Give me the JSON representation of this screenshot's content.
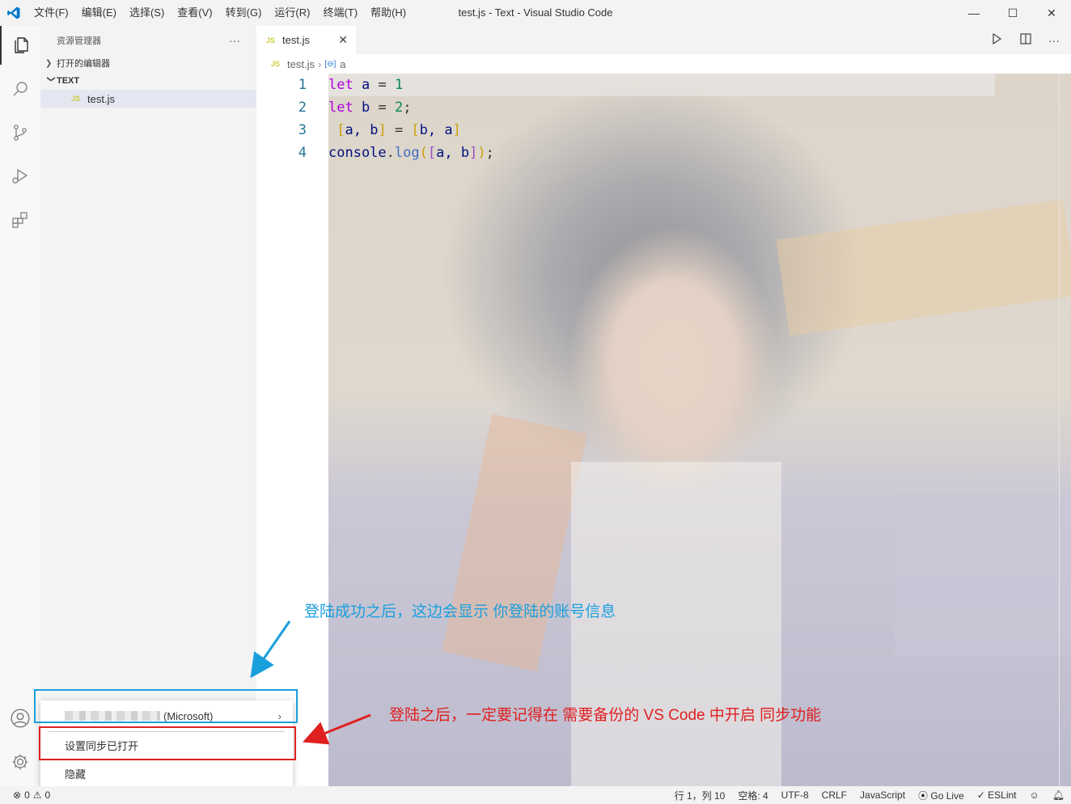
{
  "titlebar": {
    "menus": [
      "文件(F)",
      "编辑(E)",
      "选择(S)",
      "查看(V)",
      "转到(G)",
      "运行(R)",
      "终端(T)",
      "帮助(H)"
    ],
    "title": "test.js - Text - Visual Studio Code",
    "minimize": "—",
    "maximize": "☐",
    "close": "✕"
  },
  "sidebar": {
    "title": "资源管理器",
    "more": "···",
    "open_editors": "打开的编辑器",
    "folder": "TEXT",
    "file_badge": "JS",
    "file": "test.js"
  },
  "tab": {
    "badge": "JS",
    "label": "test.js",
    "close": "✕"
  },
  "breadcrumb": {
    "file_badge": "JS",
    "file": "test.js",
    "symbol_badge": "[⊖]",
    "symbol": "a"
  },
  "editor": {
    "line_numbers": [
      "1",
      "2",
      "3",
      "4"
    ],
    "code": {
      "l1_kw": "let",
      "l1_id": "a",
      "l1_op": " = ",
      "l1_num": "1",
      "l2_kw": "let",
      "l2_id": "b",
      "l2_op": " = ",
      "l2_num": "2",
      "l2_end": ";",
      "l3_pre": " ",
      "l3_open": "[",
      "l3_mid1": "a, b",
      "l3_close": "]",
      "l3_op": " = ",
      "l3_open2": "[",
      "l3_mid2": "b, a",
      "l3_close2": "]",
      "l4_obj": "console",
      "l4_dot": ".",
      "l4_fn": "log",
      "l4_p1": "(",
      "l4_b1": "[",
      "l4_args": "a, b",
      "l4_b2": "]",
      "l4_p2": ")",
      "l4_end": ";"
    }
  },
  "account_menu": {
    "account_suffix": "(Microsoft)",
    "sync": "设置同步已打开",
    "hide": "隐藏",
    "arrow": "›"
  },
  "annotations": {
    "blue": "登陆成功之后，这边会显示 你登陆的账号信息",
    "red": "登陆之后，一定要记得在 需要备份的  VS Code 中开启  同步功能"
  },
  "statusbar": {
    "errors": "0",
    "warnings": "0",
    "position": "行 1，列 10",
    "spaces": "空格: 4",
    "encoding": "UTF-8",
    "eol": "CRLF",
    "language": "JavaScript",
    "golive": "Go Live",
    "eslint": "ESLint"
  },
  "colors": {
    "vscode_blue": "#007acc",
    "annotation_blue": "#1a9fdd",
    "annotation_red": "#e02020"
  }
}
